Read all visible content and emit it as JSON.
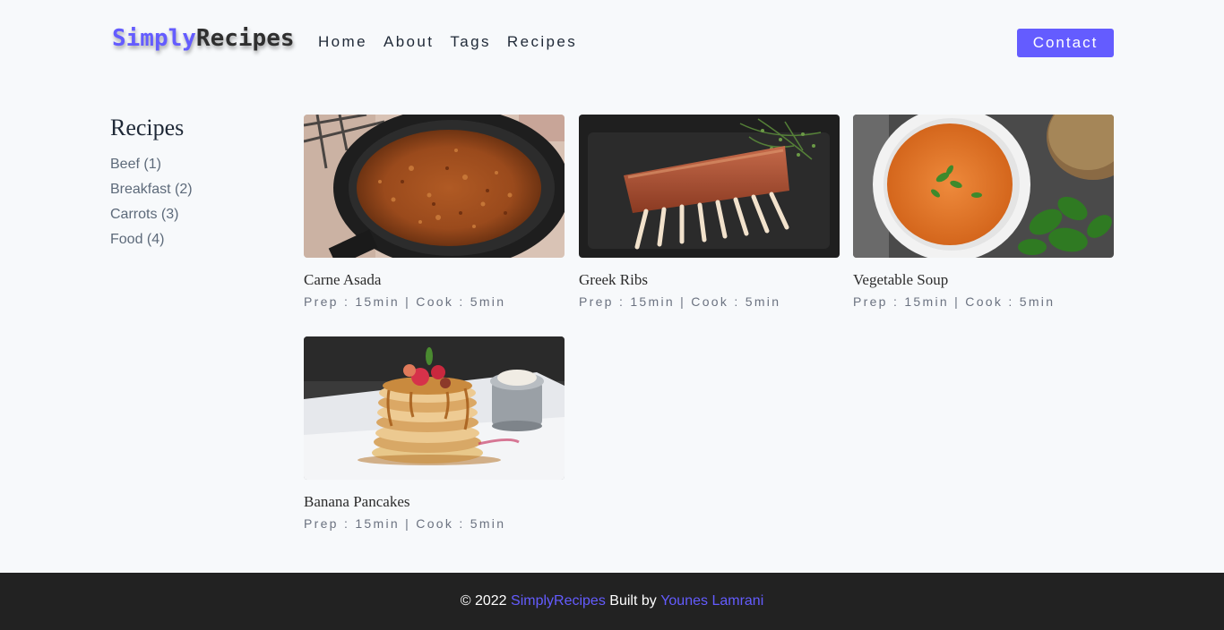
{
  "navbar": {
    "logo_part1": "Simply",
    "logo_part2": "Recipes",
    "links": [
      "Home",
      "About",
      "Tags",
      "Recipes"
    ],
    "contact_label": "Contact"
  },
  "sidebar": {
    "heading": "Recipes",
    "tags": [
      "Beef (1)",
      "Breakfast (2)",
      "Carrots (3)",
      "Food (4)"
    ]
  },
  "recipes": [
    {
      "title": "Carne Asada",
      "meta": "Prep : 15min | Cook : 5min",
      "image": "carne-asada-photo"
    },
    {
      "title": "Greek Ribs",
      "meta": "Prep : 15min | Cook : 5min",
      "image": "greek-ribs-photo"
    },
    {
      "title": "Vegetable Soup",
      "meta": "Prep : 15min | Cook : 5min",
      "image": "vegetable-soup-photo"
    },
    {
      "title": "Banana Pancakes",
      "meta": "Prep : 15min | Cook : 5min",
      "image": "banana-pancakes-photo"
    }
  ],
  "footer": {
    "copyright": "© 2022",
    "brand": "SimplyRecipes",
    "built_by": "Built by",
    "author": "Younes Lamrani"
  },
  "colors": {
    "accent": "#645cff",
    "background": "#f7f9fb",
    "footer_bg": "#222222"
  }
}
